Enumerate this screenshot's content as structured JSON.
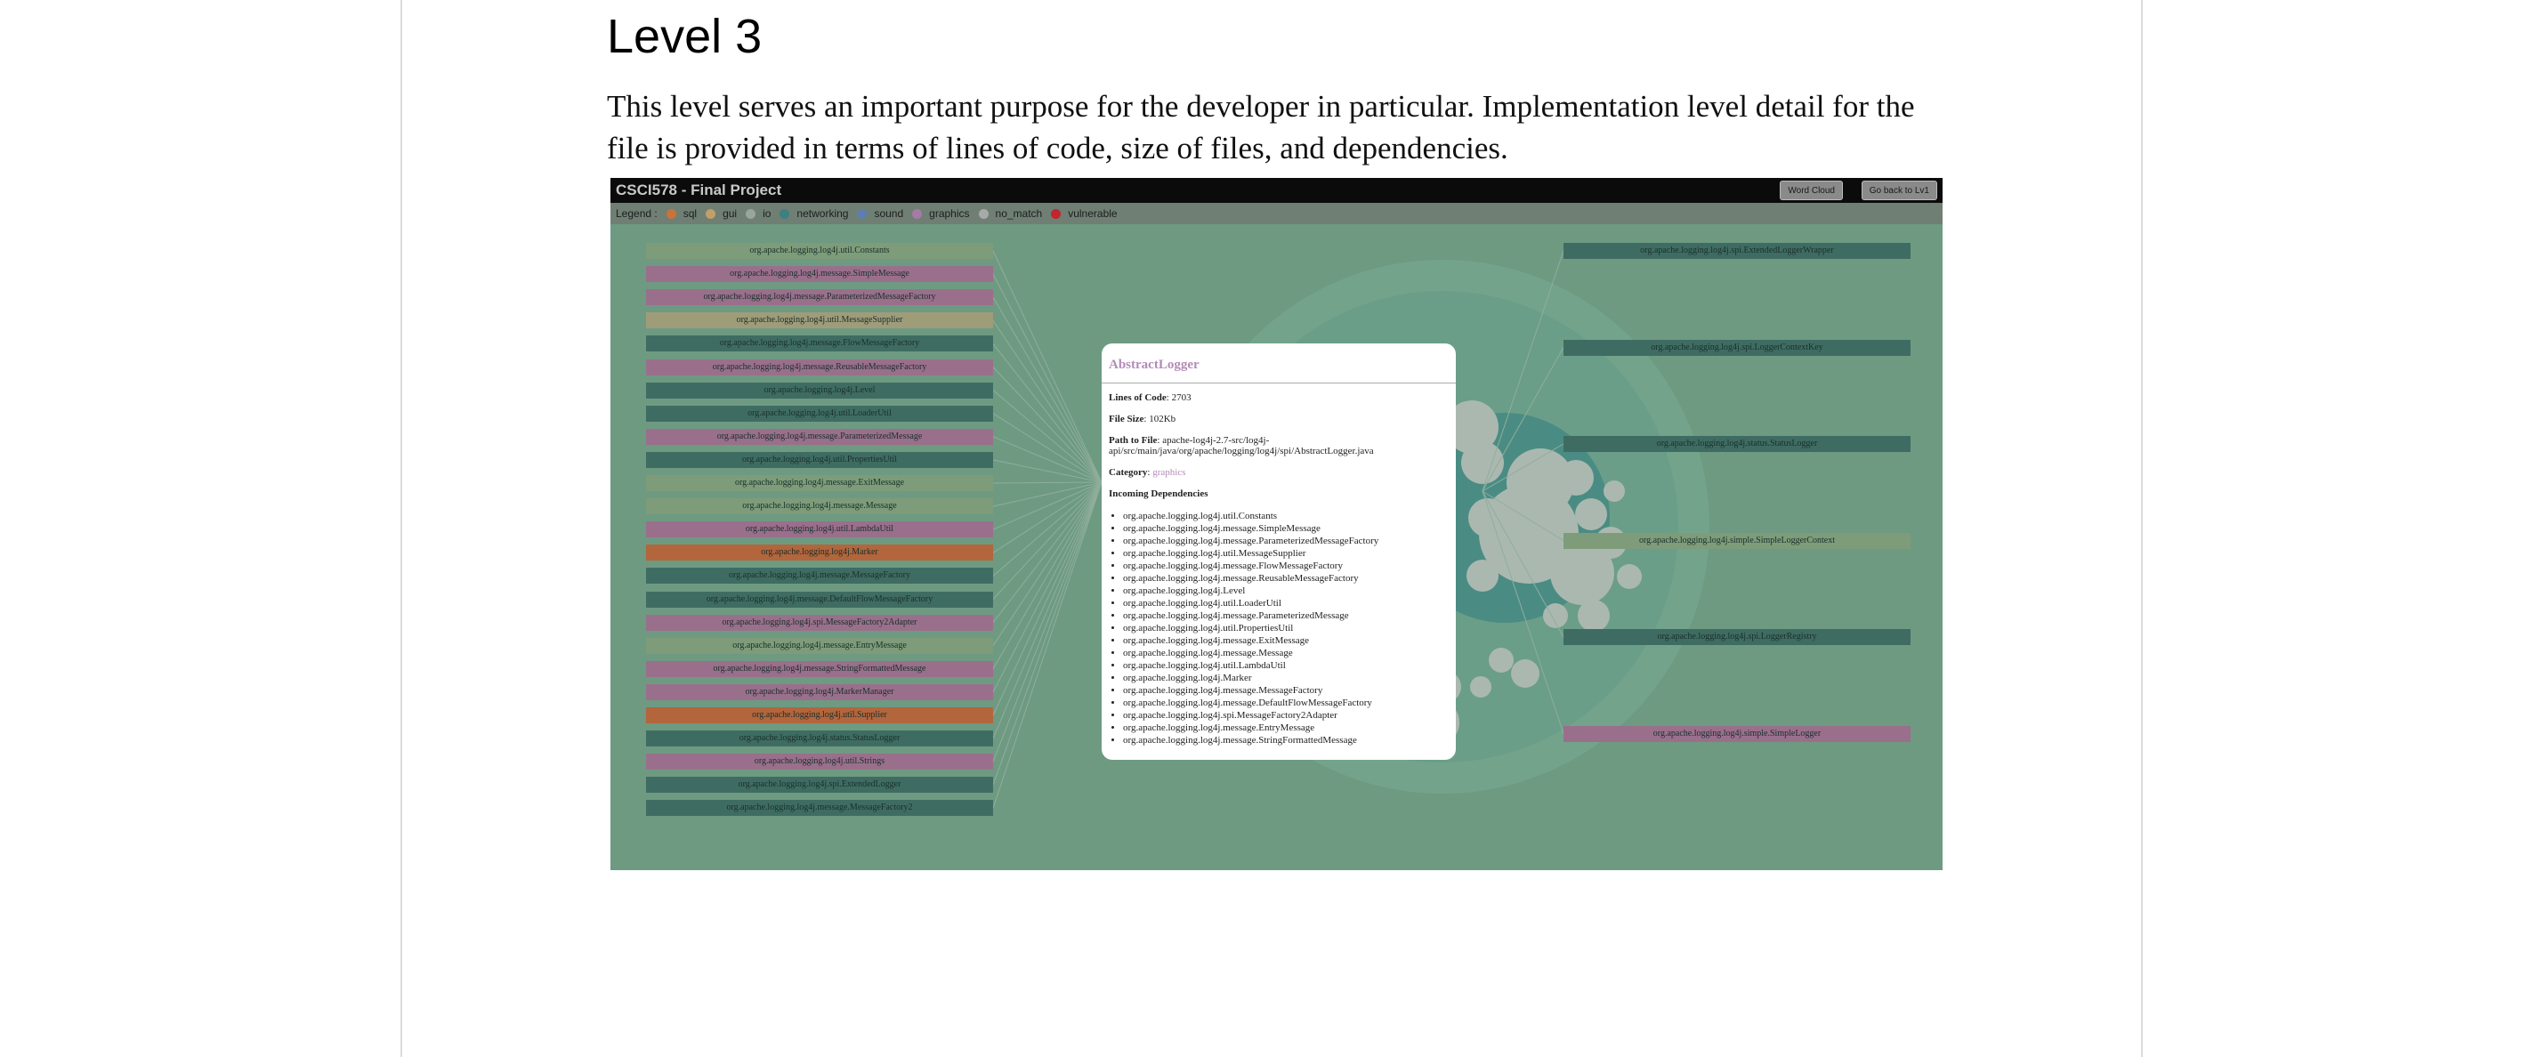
{
  "heading": "Level 3",
  "paragraph": "This level serves an important purpose for the developer in particular. Implementation level detail for the file is provided in terms of lines of code, size of files, and dependencies.",
  "app": {
    "title": "CSCI578 - Final Project",
    "buttons": {
      "word_cloud": "Word Cloud",
      "go_back": "Go back to Lv1"
    },
    "legend": {
      "title": "Legend :",
      "items": [
        {
          "label": "sql",
          "color": "#c9733a"
        },
        {
          "label": "gui",
          "color": "#c0a068"
        },
        {
          "label": "io",
          "color": "#9aa69a"
        },
        {
          "label": "networking",
          "color": "#3e7f82"
        },
        {
          "label": "sound",
          "color": "#5c7fb0"
        },
        {
          "label": "graphics",
          "color": "#a77aa6"
        },
        {
          "label": "no_match",
          "color": "#a9a9a9"
        },
        {
          "label": "vulnerable",
          "color": "#c0262c"
        }
      ]
    },
    "incoming_boxes": [
      {
        "label": "org.apache.logging.log4j.util.Constants",
        "category": "io"
      },
      {
        "label": "org.apache.logging.log4j.message.SimpleMessage",
        "category": "graphics"
      },
      {
        "label": "org.apache.logging.log4j.message.ParameterizedMessageFactory",
        "category": "graphics"
      },
      {
        "label": "org.apache.logging.log4j.util.MessageSupplier",
        "category": "gui"
      },
      {
        "label": "org.apache.logging.log4j.message.FlowMessageFactory",
        "category": "networking"
      },
      {
        "label": "org.apache.logging.log4j.message.ReusableMessageFactory",
        "category": "graphics"
      },
      {
        "label": "org.apache.logging.log4j.Level",
        "category": "networking"
      },
      {
        "label": "org.apache.logging.log4j.util.LoaderUtil",
        "category": "networking"
      },
      {
        "label": "org.apache.logging.log4j.message.ParameterizedMessage",
        "category": "graphics"
      },
      {
        "label": "org.apache.logging.log4j.util.PropertiesUtil",
        "category": "networking"
      },
      {
        "label": "org.apache.logging.log4j.message.ExitMessage",
        "category": "io"
      },
      {
        "label": "org.apache.logging.log4j.message.Message",
        "category": "io"
      },
      {
        "label": "org.apache.logging.log4j.util.LambdaUtil",
        "category": "graphics"
      },
      {
        "label": "org.apache.logging.log4j.Marker",
        "category": "sql"
      },
      {
        "label": "org.apache.logging.log4j.message.MessageFactory",
        "category": "networking"
      },
      {
        "label": "org.apache.logging.log4j.message.DefaultFlowMessageFactory",
        "category": "networking"
      },
      {
        "label": "org.apache.logging.log4j.spi.MessageFactory2Adapter",
        "category": "graphics"
      },
      {
        "label": "org.apache.logging.log4j.message.EntryMessage",
        "category": "io"
      },
      {
        "label": "org.apache.logging.log4j.message.StringFormattedMessage",
        "category": "graphics"
      },
      {
        "label": "org.apache.logging.log4j.MarkerManager",
        "category": "graphics"
      },
      {
        "label": "org.apache.logging.log4j.util.Supplier",
        "category": "sql"
      },
      {
        "label": "org.apache.logging.log4j.status.StatusLogger",
        "category": "networking"
      },
      {
        "label": "org.apache.logging.log4j.util.Strings",
        "category": "graphics"
      },
      {
        "label": "org.apache.logging.log4j.spi.ExtendedLogger",
        "category": "networking"
      },
      {
        "label": "org.apache.logging.log4j.message.MessageFactory2",
        "category": "networking"
      }
    ],
    "outgoing_boxes": [
      {
        "label": "org.apache.logging.log4j.spi.ExtendedLoggerWrapper",
        "category": "networking"
      },
      {
        "label": "org.apache.logging.log4j.spi.LoggerContextKey",
        "category": "networking"
      },
      {
        "label": "org.apache.logging.log4j.status.StatusLogger",
        "category": "networking"
      },
      {
        "label": "org.apache.logging.log4j.simple.SimpleLoggerContext",
        "category": "io"
      },
      {
        "label": "org.apache.logging.log4j.spi.LoggerRegistry",
        "category": "networking"
      },
      {
        "label": "org.apache.logging.log4j.simple.SimpleLogger",
        "category": "graphics"
      }
    ],
    "category_box_colors": {
      "io": "#7e9c7a",
      "graphics": "#9a6f8c",
      "gui": "#9f9c7a",
      "networking": "#3f6c62",
      "sql": "#b3653c"
    },
    "popup": {
      "title": "AbstractLogger",
      "lines_of_code_label": "Lines of Code",
      "lines_of_code": "2703",
      "file_size_label": "File Size",
      "file_size": "102Kb",
      "path_label": "Path to File",
      "path": "apache-log4j-2.7-src/log4j-api/src/main/java/org/apache/logging/log4j/spi/AbstractLogger.java",
      "category_label": "Category",
      "category": "graphics",
      "incoming_label": "Incoming Dependencies",
      "incoming": [
        "org.apache.logging.log4j.util.Constants",
        "org.apache.logging.log4j.message.SimpleMessage",
        "org.apache.logging.log4j.message.ParameterizedMessageFactory",
        "org.apache.logging.log4j.util.MessageSupplier",
        "org.apache.logging.log4j.message.FlowMessageFactory",
        "org.apache.logging.log4j.message.ReusableMessageFactory",
        "org.apache.logging.log4j.Level",
        "org.apache.logging.log4j.util.LoaderUtil",
        "org.apache.logging.log4j.message.ParameterizedMessage",
        "org.apache.logging.log4j.util.PropertiesUtil",
        "org.apache.logging.log4j.message.ExitMessage",
        "org.apache.logging.log4j.message.Message",
        "org.apache.logging.log4j.util.LambdaUtil",
        "org.apache.logging.log4j.Marker",
        "org.apache.logging.log4j.message.MessageFactory",
        "org.apache.logging.log4j.message.DefaultFlowMessageFactory",
        "org.apache.logging.log4j.spi.MessageFactory2Adapter",
        "org.apache.logging.log4j.message.EntryMessage",
        "org.apache.logging.log4j.message.StringFormattedMessage"
      ]
    }
  }
}
